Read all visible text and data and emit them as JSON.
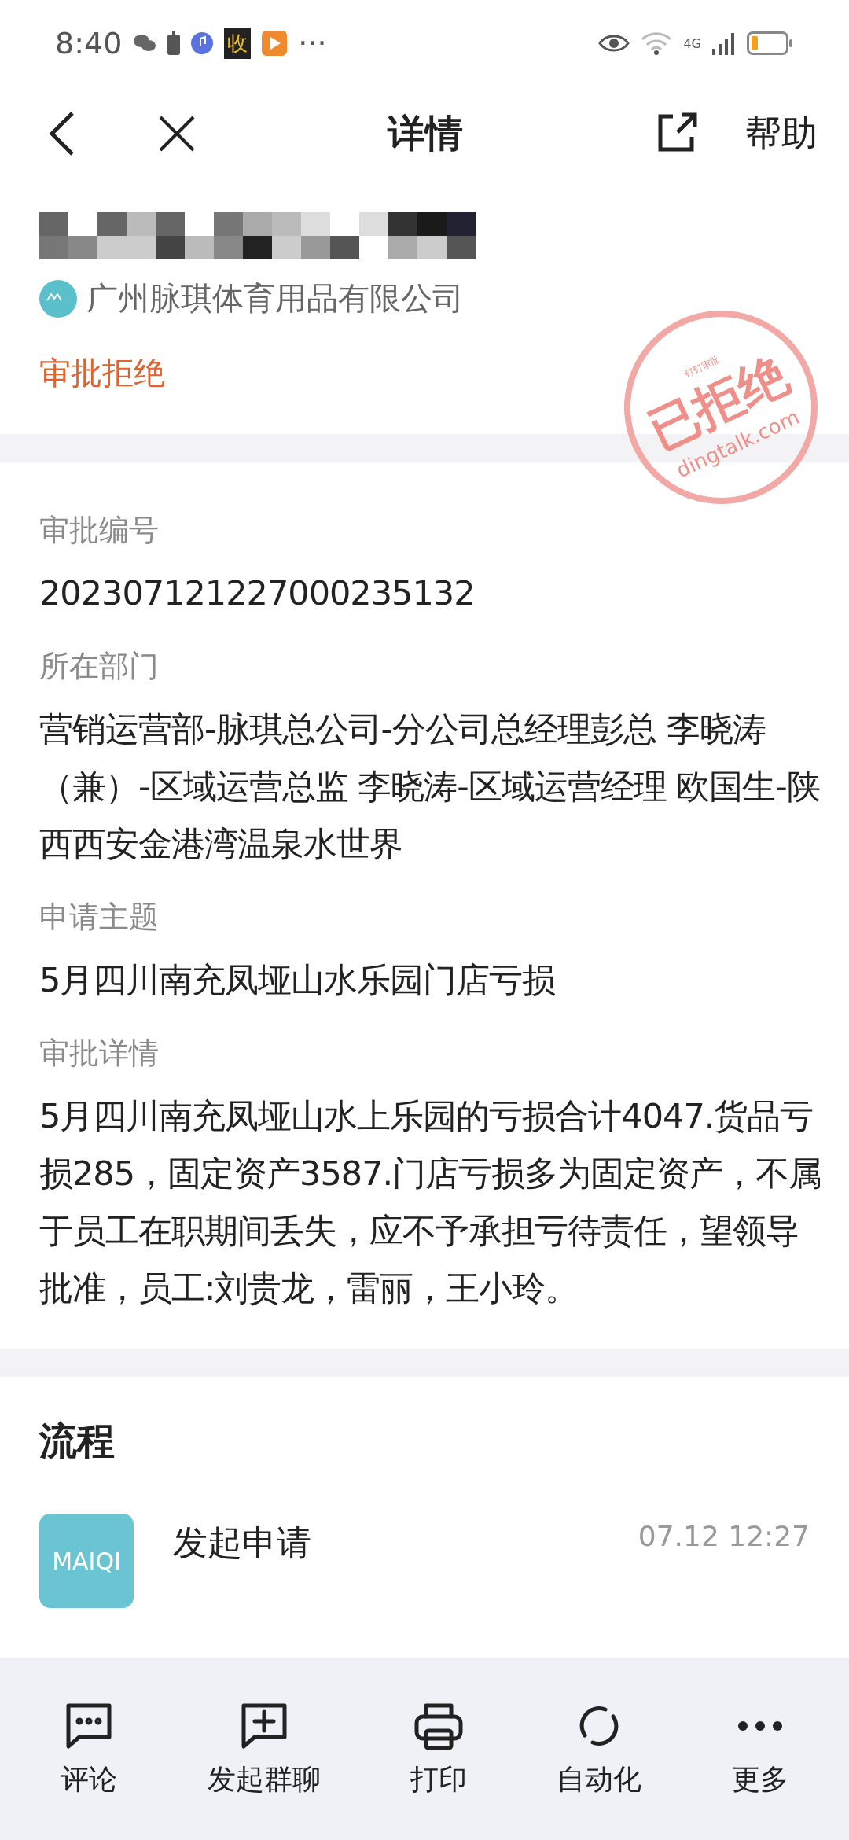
{
  "status_bar": {
    "time": "8:40",
    "app_badge": "收",
    "more": "···",
    "network": "4G"
  },
  "nav": {
    "title": "详情",
    "help": "帮助"
  },
  "header": {
    "company": "广州脉琪体育用品有限公司",
    "status": "审批拒绝",
    "stamp": {
      "text": "已拒绝",
      "top": "钉钉审批",
      "domain": "dingtalk.com"
    }
  },
  "fields": [
    {
      "label": "审批编号",
      "value": "202307121227000235132"
    },
    {
      "label": "所在部门",
      "value": "营销运营部-脉琪总公司-分公司总经理彭总 李晓涛（兼）-区域运营总监 李晓涛-区域运营经理 欧国生-陕西西安金港湾温泉水世界"
    },
    {
      "label": "申请主题",
      "value": "5月四川南充凤垭山水乐园门店亏损"
    },
    {
      "label": "审批详情",
      "value": "5月四川南充凤垭山水上乐园的亏损合计4047.货品亏损285，固定资产3587.门店亏损多为固定资产，不属于员工在职期间丢失，应不予承担亏待责任，望领导批准，员工:刘贵龙，雷丽，王小玲。"
    }
  ],
  "flow": {
    "title": "流程",
    "steps": [
      {
        "logo": "MAIQI",
        "action": "发起申请",
        "time": "07.12 12:27"
      }
    ]
  },
  "actions": [
    {
      "kind": "comment",
      "label": "评论"
    },
    {
      "kind": "group",
      "label": "发起群聊"
    },
    {
      "kind": "print",
      "label": "打印"
    },
    {
      "kind": "auto",
      "label": "自动化"
    },
    {
      "kind": "more",
      "label": "更多"
    }
  ]
}
